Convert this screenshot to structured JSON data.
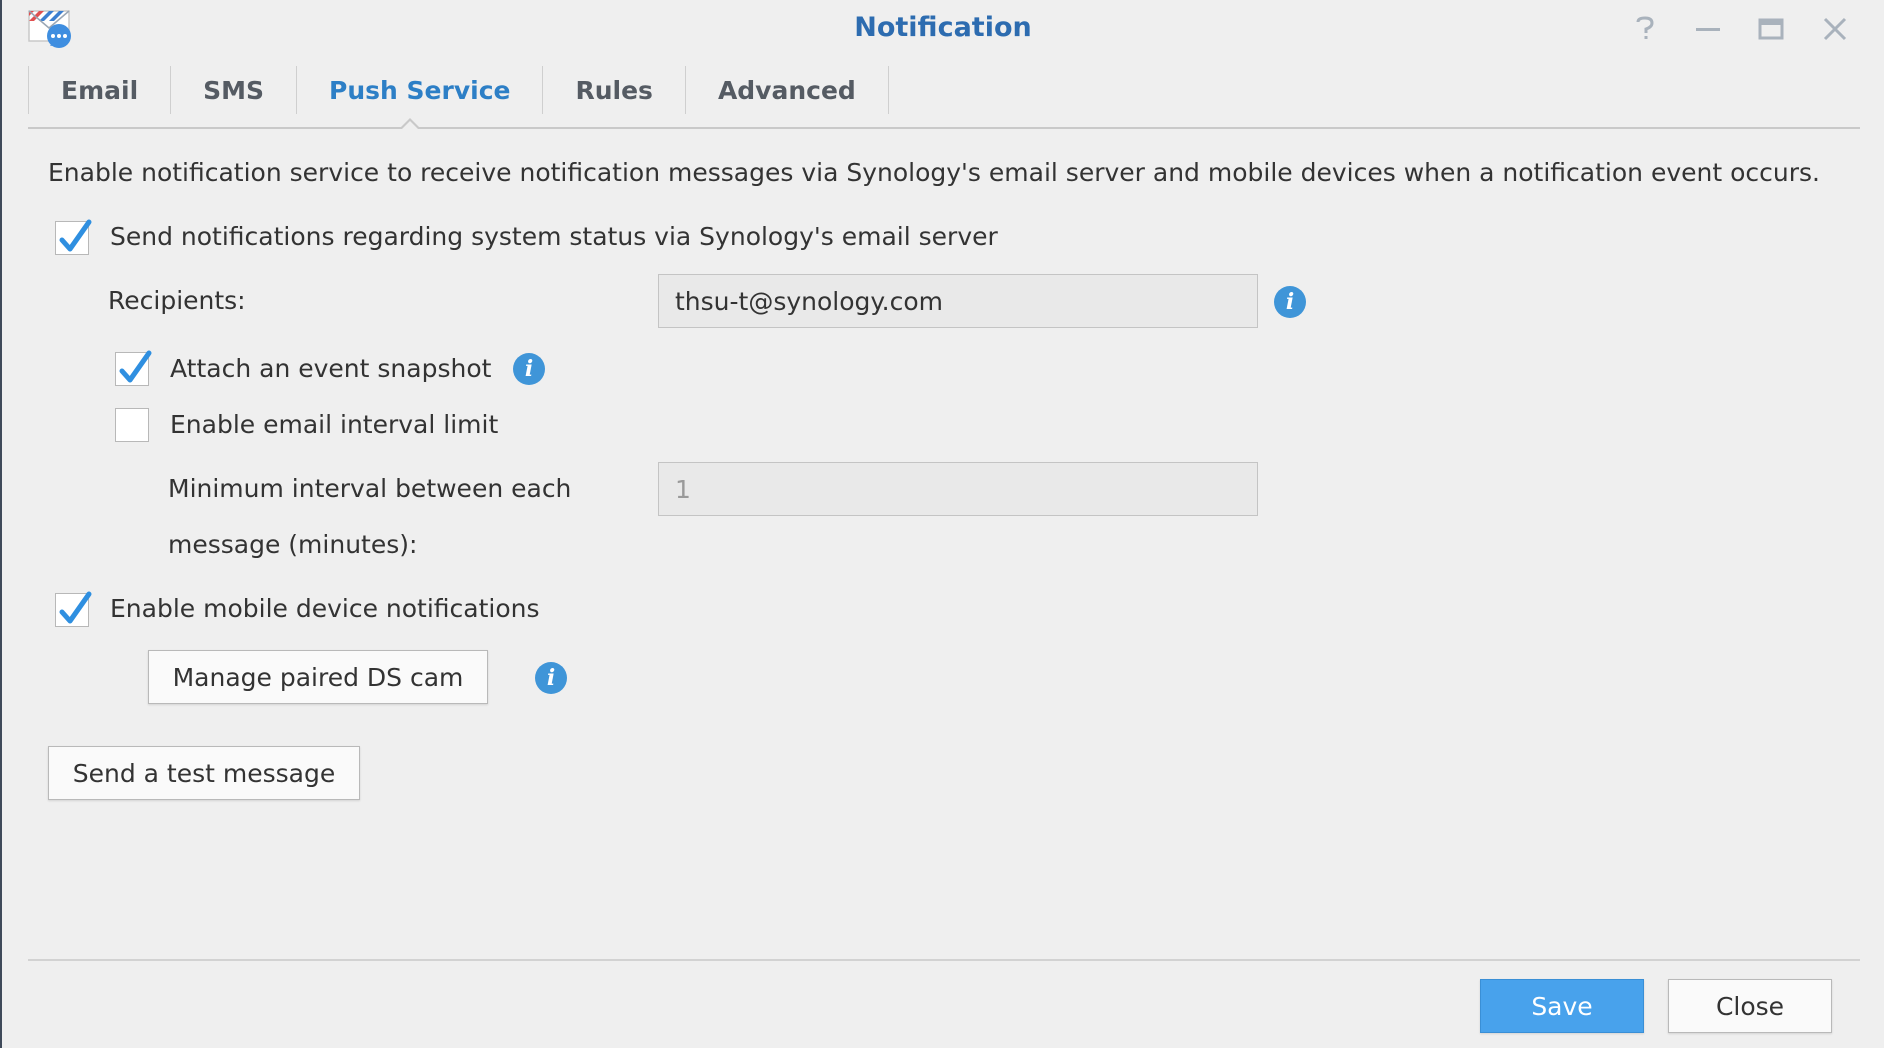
{
  "window": {
    "title": "Notification",
    "app_icon": "mail-chat-icon",
    "controls": [
      "help-icon",
      "minimize-icon",
      "maximize-icon",
      "close-icon"
    ]
  },
  "tabs": [
    {
      "label": "Email"
    },
    {
      "label": "SMS"
    },
    {
      "label": "Push Service",
      "active": true
    },
    {
      "label": "Rules"
    },
    {
      "label": "Advanced"
    }
  ],
  "push": {
    "description": "Enable notification service to receive notification messages via Synology's email server and mobile devices when a notification event occurs.",
    "send_status_label": "Send notifications regarding system status via Synology's email server",
    "send_status_checked": true,
    "recipients_label": "Recipients:",
    "recipients_value": "thsu-t@synology.com",
    "attach_snapshot_label": "Attach an event snapshot",
    "attach_snapshot_checked": true,
    "interval_limit_label": "Enable email interval limit",
    "interval_limit_checked": false,
    "min_interval_label_line1": "Minimum interval between each",
    "min_interval_label_line2": "message (minutes):",
    "min_interval_value": "1",
    "mobile_label": "Enable mobile device notifications",
    "mobile_checked": true,
    "manage_ds_cam_label": "Manage paired DS cam",
    "test_message_label": "Send a test message"
  },
  "footer": {
    "save_label": "Save",
    "close_label": "Close"
  },
  "colors": {
    "accent": "#2d6cb0",
    "tab_active": "#2d7fc6",
    "primary_button": "#48a2ec",
    "checkmark": "#2f8fe0",
    "info": "#3f95d8",
    "background": "#efefef"
  }
}
